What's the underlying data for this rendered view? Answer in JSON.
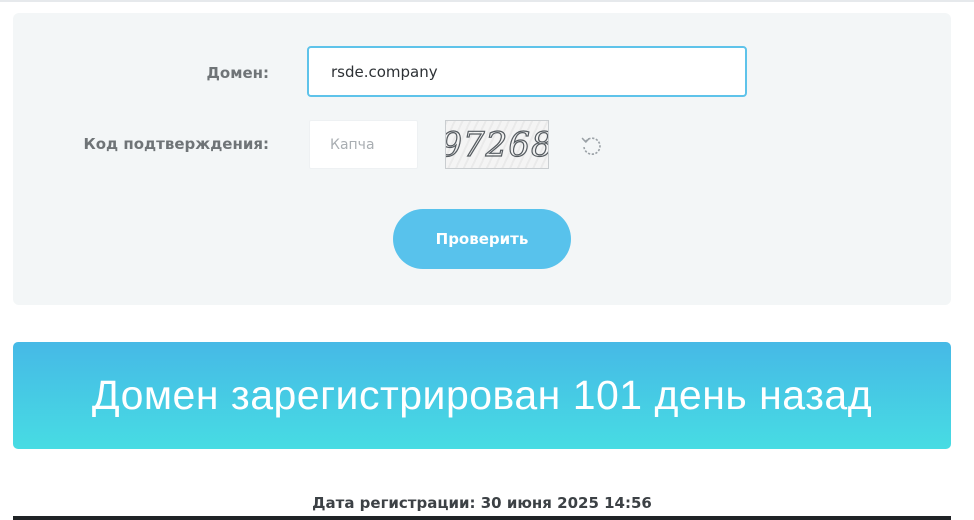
{
  "form": {
    "domain_label": "Домен:",
    "domain_value": "rsde.company",
    "captcha_label": "Код подтверждения:",
    "captcha_placeholder": "Капча",
    "captcha_image_text": "97268",
    "refresh_icon": "refresh-icon",
    "submit_label": "Проверить"
  },
  "result": {
    "headline": "Домен зарегистрирован 101 день назад",
    "registration_date": "Дата регистрации: 30 июня 2025 14:56"
  },
  "colors": {
    "accent": "#58c2ec",
    "input_border": "#5ec3ea",
    "banner_top": "#46b9e6",
    "banner_bottom": "#47dce3",
    "panel_bg": "#f3f6f7"
  }
}
